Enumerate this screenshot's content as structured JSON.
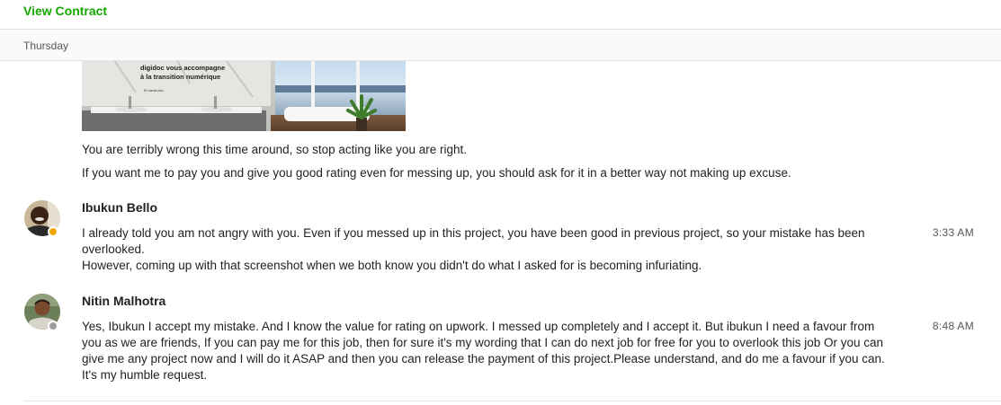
{
  "header": {
    "view_contract_label": "View Contract"
  },
  "date_divider": {
    "label": "Thursday"
  },
  "attachment": {
    "image_text_line1": "digidoc vous accompagne",
    "image_text_line2": "à la transition numérique",
    "image_button": "En savoir plus"
  },
  "previous_messages": [
    "You are terribly wrong this time around, so stop acting like you are right.",
    "If you want me to pay you and give you good rating even for messing up, you should ask for it in a better way not making up excuse."
  ],
  "messages": [
    {
      "sender": "Ibukun Bello",
      "status_color": "#f0a800",
      "time": "3:33 AM",
      "lines": [
        "I already told you am not angry with you. Even if you messed up in this project, you have been good in previous project, so your mistake has been overlooked.",
        "However, coming up with that screenshot when we both know you didn't do what I asked for is becoming infuriating."
      ]
    },
    {
      "sender": "Nitin Malhotra",
      "status_color": "#9e9e9e",
      "time": "8:48 AM",
      "lines": [
        "Yes, Ibukun I accept my mistake. And I know the value for rating on upwork. I messed up completely and I accept it. But ibukun I need a favour from you as we are friends, If you can pay me for this job, then for sure it's my wording that I can do next job for free for you to overlook this job Or you can give me any project now and I will do it ASAP and then you can release the payment of this project.Please understand, and do me a favour if you can. It's my humble request."
      ]
    }
  ],
  "colors": {
    "accent_green": "#14a800",
    "text": "#222222",
    "muted": "#555555",
    "divider": "#e4e4e4"
  },
  "icons": {
    "attachment": "shared-image-thumbnail",
    "avatar_1": "avatar-photo",
    "avatar_2": "avatar-photo"
  }
}
